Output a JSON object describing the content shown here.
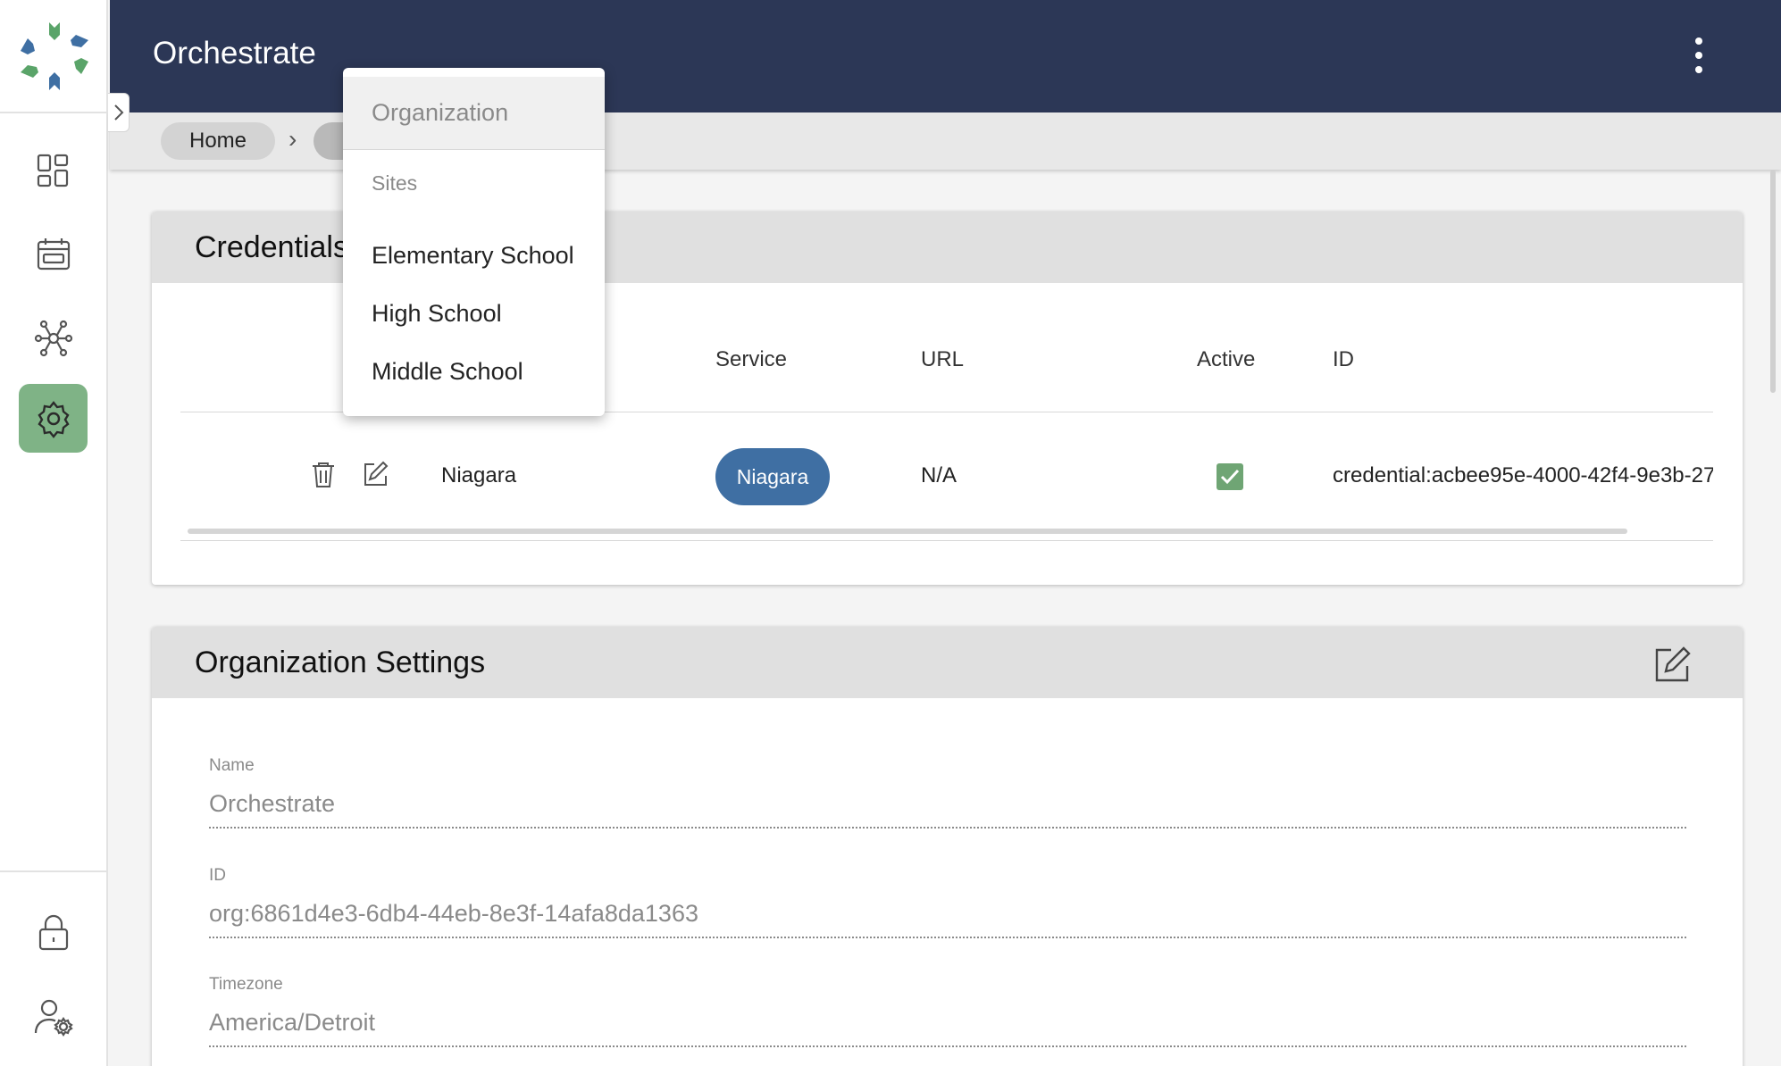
{
  "app": {
    "title": "Orchestrate"
  },
  "breadcrumb": {
    "home": "Home",
    "separator": "›"
  },
  "nav_icons": [
    "dashboard-icon",
    "calendar-icon",
    "network-icon",
    "gear-icon",
    "lock-icon",
    "user-settings-icon"
  ],
  "dropdown": {
    "header": "Organization",
    "section": "Sites",
    "items": [
      "Elementary School",
      "High School",
      "Middle School"
    ]
  },
  "credentials": {
    "title": "Credentials",
    "columns": [
      "Service",
      "URL",
      "Active",
      "ID"
    ],
    "rows": [
      {
        "name": "Niagara",
        "service": "Niagara",
        "url": "N/A",
        "active": true,
        "id": "credential:acbee95e-4000-42f4-9e3b-27"
      }
    ]
  },
  "org_settings": {
    "title": "Organization Settings",
    "fields": [
      {
        "label": "Name",
        "value": "Orchestrate"
      },
      {
        "label": "ID",
        "value": "org:6861d4e3-6db4-44eb-8e3f-14afa8da1363"
      },
      {
        "label": "Timezone",
        "value": "America/Detroit"
      }
    ]
  },
  "colors": {
    "header_bg": "#2c3756",
    "active_nav": "#7fb386",
    "service_pill": "#3f6fa3",
    "checkbox": "#6fa574"
  }
}
